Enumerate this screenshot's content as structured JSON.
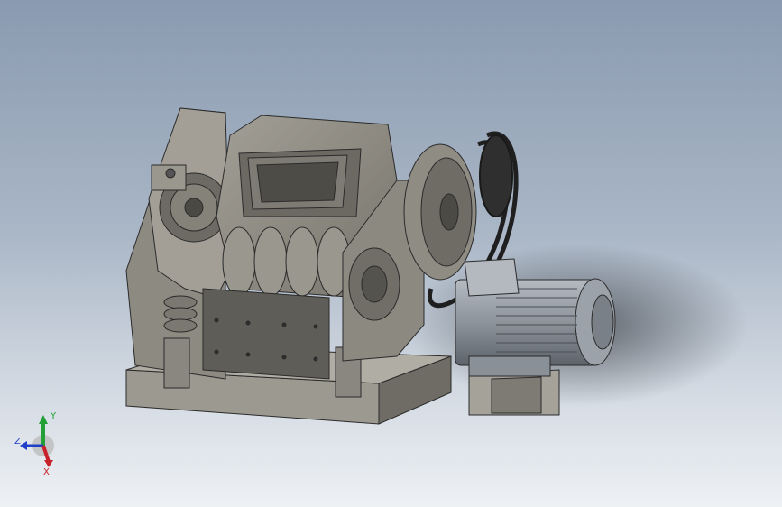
{
  "viewport": {
    "background_top": "#8a9ab0",
    "background_bottom": "#eef1f4"
  },
  "model": {
    "body_color": "#8c8a82",
    "body_dark": "#5a5952",
    "motor_color": "#9aa0a8",
    "belt_color": "#2a2a2a",
    "outline": "#2b2b2b"
  },
  "triad": {
    "x_label": "X",
    "y_label": "Y",
    "z_label": "Z",
    "x_color": "#c8202a",
    "y_color": "#22a035",
    "z_color": "#1f3fc8"
  }
}
